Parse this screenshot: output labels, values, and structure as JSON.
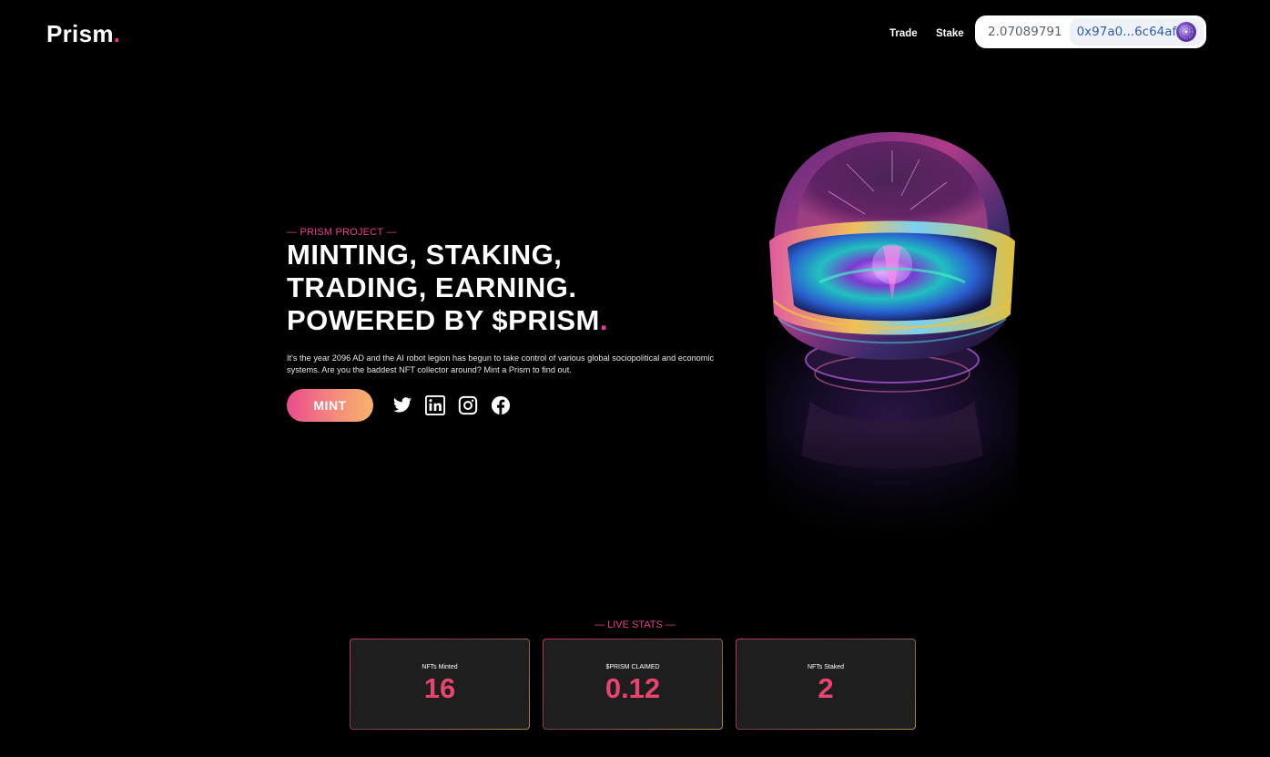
{
  "header": {
    "logo_text": "Prism",
    "logo_dot": ".",
    "nav": {
      "trade": "Trade",
      "stake": "Stake"
    },
    "wallet": {
      "balance": "2.07089791",
      "address": "0x97a0...6c64af"
    }
  },
  "hero": {
    "kicker": "— PRISM PROJECT —",
    "headline_lines": [
      "MINTING, STAKING,",
      "TRADING, EARNING.",
      "POWERED BY $PRISM"
    ],
    "headline_dot": ".",
    "description": "It's the year 2096 AD and the AI robot legion has begun to take control of various global sociopolitical and economic systems. Are you the baddest NFT collector around? Mint a Prism to find out.",
    "mint_label": "MINT",
    "socials": [
      "twitter-icon",
      "linkedin-icon",
      "instagram-icon",
      "facebook-icon"
    ]
  },
  "stats": {
    "label": "— LIVE STATS —",
    "cards": [
      {
        "label": "NFTs Minted",
        "value": "16"
      },
      {
        "label": "$PRISM CLAIMED",
        "value": "0.12"
      },
      {
        "label": "NFTs Staked",
        "value": "2"
      }
    ]
  },
  "colors": {
    "accent": "#e83e8c",
    "stat_value": "#e8456e",
    "background": "#000000"
  }
}
